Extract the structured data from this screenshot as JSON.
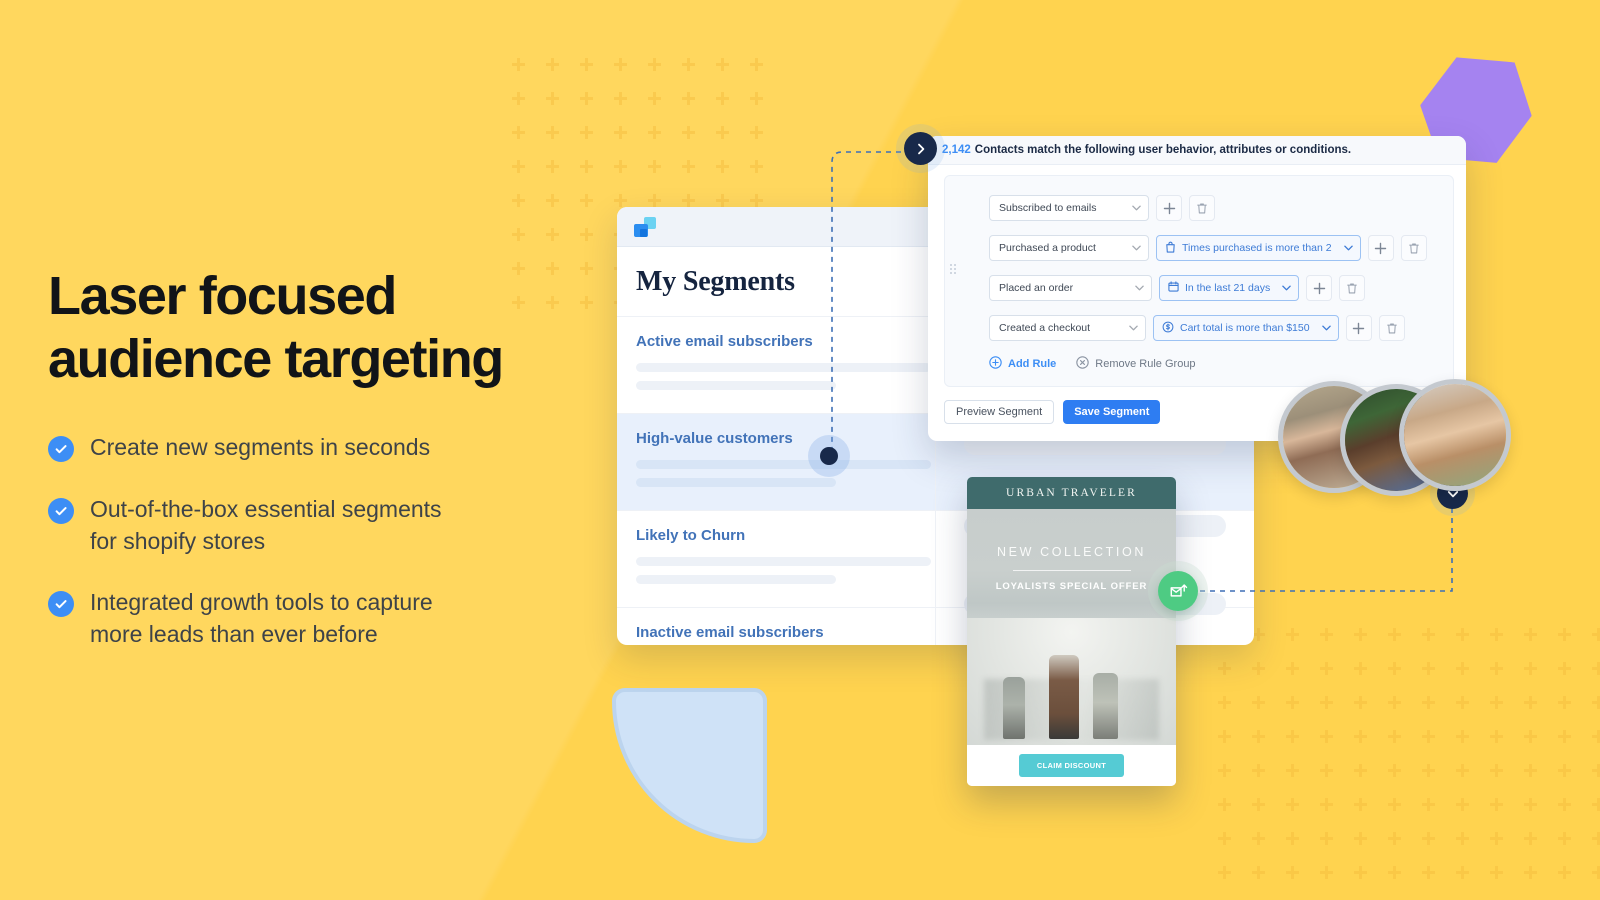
{
  "theme": {
    "bg_yellow": "#FFD34F",
    "accent_blue": "#3D8EF5",
    "navy": "#18294A",
    "green": "#4ECB83",
    "purple": "#A583F0",
    "pale_blue": "#CFE2F7"
  },
  "hero": {
    "headline": "Laser focused\naudience targeting",
    "bullets": [
      {
        "text": "Create new segments in seconds",
        "icon": "check-circle-icon"
      },
      {
        "text": "Out-of-the-box essential segments\nfor shopify stores",
        "icon": "check-circle-icon"
      },
      {
        "text": "Integrated growth tools to capture\nmore leads than ever before",
        "icon": "check-circle-icon"
      }
    ]
  },
  "segments_window": {
    "logo_icon": "app-logo-icon",
    "title": "My Segments",
    "rows": [
      {
        "name": "Active email subscribers",
        "active": false
      },
      {
        "name": "High-value customers",
        "active": true
      },
      {
        "name": "Likely to Churn",
        "active": false
      },
      {
        "name": "Inactive email subscribers",
        "active": false
      }
    ],
    "stat": {
      "value": "2,142",
      "label": "Contacts"
    }
  },
  "rule_panel": {
    "header": {
      "count": "2,142",
      "text": "Contacts match the following user behavior, attributes or conditions."
    },
    "drag_handle_icon": "drag-handle-icon",
    "rules": [
      {
        "trigger": "Subscribed to emails",
        "condition": null,
        "condition_icon": null,
        "add_icon": "plus-icon",
        "delete_icon": "trash-icon"
      },
      {
        "trigger": "Purchased a product",
        "condition": "Times purchased is more than 2",
        "condition_icon": "bag-icon",
        "add_icon": "plus-icon",
        "delete_icon": "trash-icon"
      },
      {
        "trigger": "Placed an order",
        "condition": "In the last 21 days",
        "condition_icon": "calendar-icon",
        "add_icon": "plus-icon",
        "delete_icon": "trash-icon"
      },
      {
        "trigger": "Created a checkout",
        "condition": "Cart total is more than $150",
        "condition_icon": "dollar-circle-icon",
        "add_icon": "plus-icon",
        "delete_icon": "trash-icon"
      }
    ],
    "actions": {
      "add_rule": "Add Rule",
      "add_rule_icon": "plus-circle-icon",
      "remove_group": "Remove Rule Group",
      "remove_group_icon": "x-circle-icon"
    },
    "footer": {
      "preview": "Preview Segment",
      "save": "Save Segment"
    }
  },
  "email_card": {
    "brand": "URBAN TRAVELER",
    "heading": "NEW COLLECTION",
    "subheading": "LOYALISTS SPECIAL OFFER",
    "cta": "CLAIM DISCOUNT"
  },
  "markers": {
    "nav_right_icon": "chevron-right-icon",
    "nav_down_icon": "chevron-down-icon",
    "node_icon": "node-dot-icon",
    "send_email_icon": "send-email-icon"
  },
  "decor": {
    "hexagon": "hexagon-shape",
    "quarter_blob": "quarter-circle-shape",
    "cross_pattern": "cross-dot-pattern"
  }
}
